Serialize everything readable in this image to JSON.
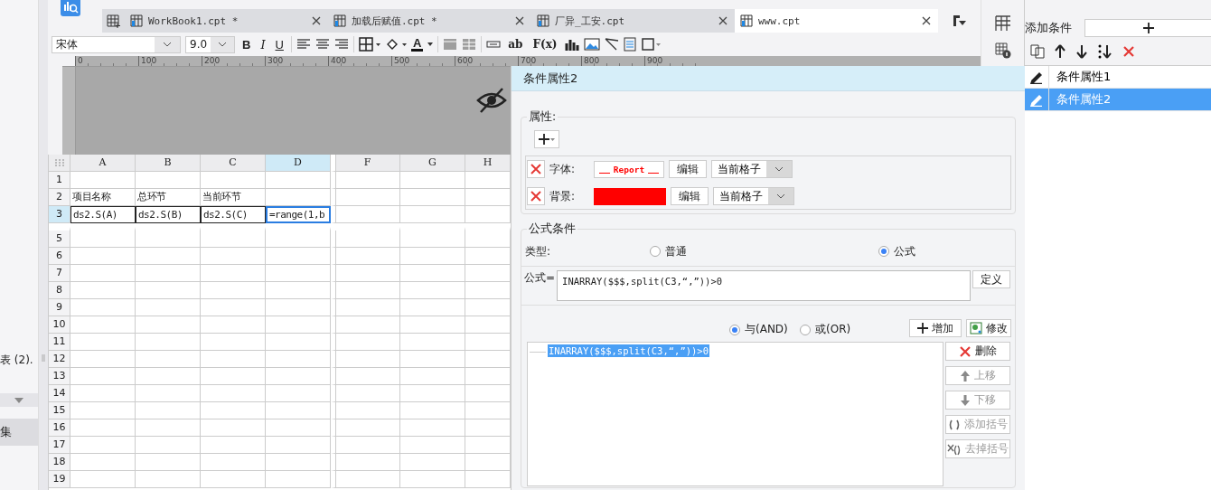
{
  "sidebar": {
    "tree_item": "表 (2).",
    "section": "集"
  },
  "tabs": [
    {
      "label": "WorkBook1.cpt *",
      "selected": false
    },
    {
      "label": "加载后赋值.cpt *",
      "selected": false
    },
    {
      "label": "厂异_工安.cpt",
      "selected": false
    },
    {
      "label": "www.cpt",
      "selected": true
    }
  ],
  "format_toolbar": {
    "font": "宋体",
    "size": "9.0",
    "style_buttons": [
      "B",
      "I",
      "U"
    ],
    "font_color": "A",
    "text_buttons": [
      "ab",
      "F(x)"
    ]
  },
  "ruler": {
    "ticks": [
      "0",
      "100",
      "200",
      "300",
      "400",
      "500",
      "600",
      "700",
      "800",
      "900"
    ]
  },
  "sheet": {
    "columns": [
      {
        "label": "A",
        "selected": false,
        "hidden_before": false
      },
      {
        "label": "B",
        "selected": false,
        "hidden_before": false
      },
      {
        "label": "C",
        "selected": false,
        "hidden_before": false
      },
      {
        "label": "D",
        "selected": true,
        "hidden_before": false
      },
      {
        "label": "F",
        "selected": false,
        "hidden_before": true
      },
      {
        "label": "G",
        "selected": false,
        "hidden_before": false
      },
      {
        "label": "H",
        "selected": false,
        "hidden_before": false
      }
    ],
    "rows": [
      {
        "label": "1",
        "selected": false,
        "hidden_before": false
      },
      {
        "label": "2",
        "selected": false,
        "hidden_before": false,
        "cells": [
          {
            "text": "项目名称",
            "selected": false
          },
          {
            "text": "总环节",
            "selected": false
          },
          {
            "text": "当前环节",
            "selected": false
          }
        ]
      },
      {
        "label": "3",
        "selected": true,
        "hidden_before": false,
        "cells": [
          {
            "text": "ds2.S(A)",
            "selected": false
          },
          {
            "text": "ds2.S(B)",
            "selected": false
          },
          {
            "text": "ds2.S(C)",
            "selected": false
          },
          {
            "text": "=range(1,b",
            "selected": true
          }
        ]
      },
      {
        "label": "5",
        "selected": false,
        "hidden_before": true
      },
      {
        "label": "6",
        "selected": false,
        "hidden_before": false
      },
      {
        "label": "7",
        "selected": false,
        "hidden_before": false
      },
      {
        "label": "8",
        "selected": false,
        "hidden_before": false
      },
      {
        "label": "9",
        "selected": false,
        "hidden_before": false
      },
      {
        "label": "10",
        "selected": false,
        "hidden_before": false
      },
      {
        "label": "11",
        "selected": false,
        "hidden_before": false
      },
      {
        "label": "12",
        "selected": false,
        "hidden_before": false
      },
      {
        "label": "13",
        "selected": false,
        "hidden_before": false
      },
      {
        "label": "14",
        "selected": false,
        "hidden_before": false
      },
      {
        "label": "15",
        "selected": false,
        "hidden_before": false
      },
      {
        "label": "16",
        "selected": false,
        "hidden_before": false
      },
      {
        "label": "17",
        "selected": false,
        "hidden_before": false
      },
      {
        "label": "18",
        "selected": false,
        "hidden_before": false
      },
      {
        "label": "19",
        "selected": false,
        "hidden_before": false
      }
    ]
  },
  "dialog": {
    "title": "条件属性2",
    "attributes": {
      "legend": "属性:",
      "properties": [
        {
          "kind": "font",
          "label": "字体:",
          "preview": "Report",
          "edit": "编辑",
          "scope": "当前格子"
        },
        {
          "kind": "background",
          "label": "背景:",
          "color": "#ff0000",
          "edit": "编辑",
          "scope": "当前格子"
        }
      ]
    },
    "formula_condition": {
      "legend": "公式条件",
      "type_label": "类型:",
      "types": [
        {
          "label": "普通",
          "selected": false
        },
        {
          "label": "公式",
          "selected": true
        }
      ],
      "formula_label": "公式=",
      "formula": "INARRAY($$$,split(C3,“,”))>0",
      "define": "定义",
      "logic": [
        {
          "label": "与(AND)",
          "selected": true
        },
        {
          "label": "或(OR)",
          "selected": false
        }
      ],
      "add": "增加",
      "modify": "修改",
      "conditions": [
        {
          "text": "INARRAY($$$,split(C3,“,”))>0",
          "selected": true
        }
      ],
      "actions": [
        {
          "kind": "delete",
          "label": "删除",
          "disabled": false
        },
        {
          "kind": "up",
          "label": "上移",
          "disabled": true
        },
        {
          "kind": "down",
          "label": "下移",
          "disabled": true
        },
        {
          "kind": "add_paren",
          "label": "添加括号",
          "disabled": true
        },
        {
          "kind": "remove_paren",
          "label": "去掉括号",
          "disabled": true
        }
      ]
    }
  },
  "right_panel": {
    "add_label": "添加条件",
    "conditions": [
      {
        "label": "条件属性1",
        "selected": false
      },
      {
        "label": "条件属性2",
        "selected": true
      }
    ]
  }
}
